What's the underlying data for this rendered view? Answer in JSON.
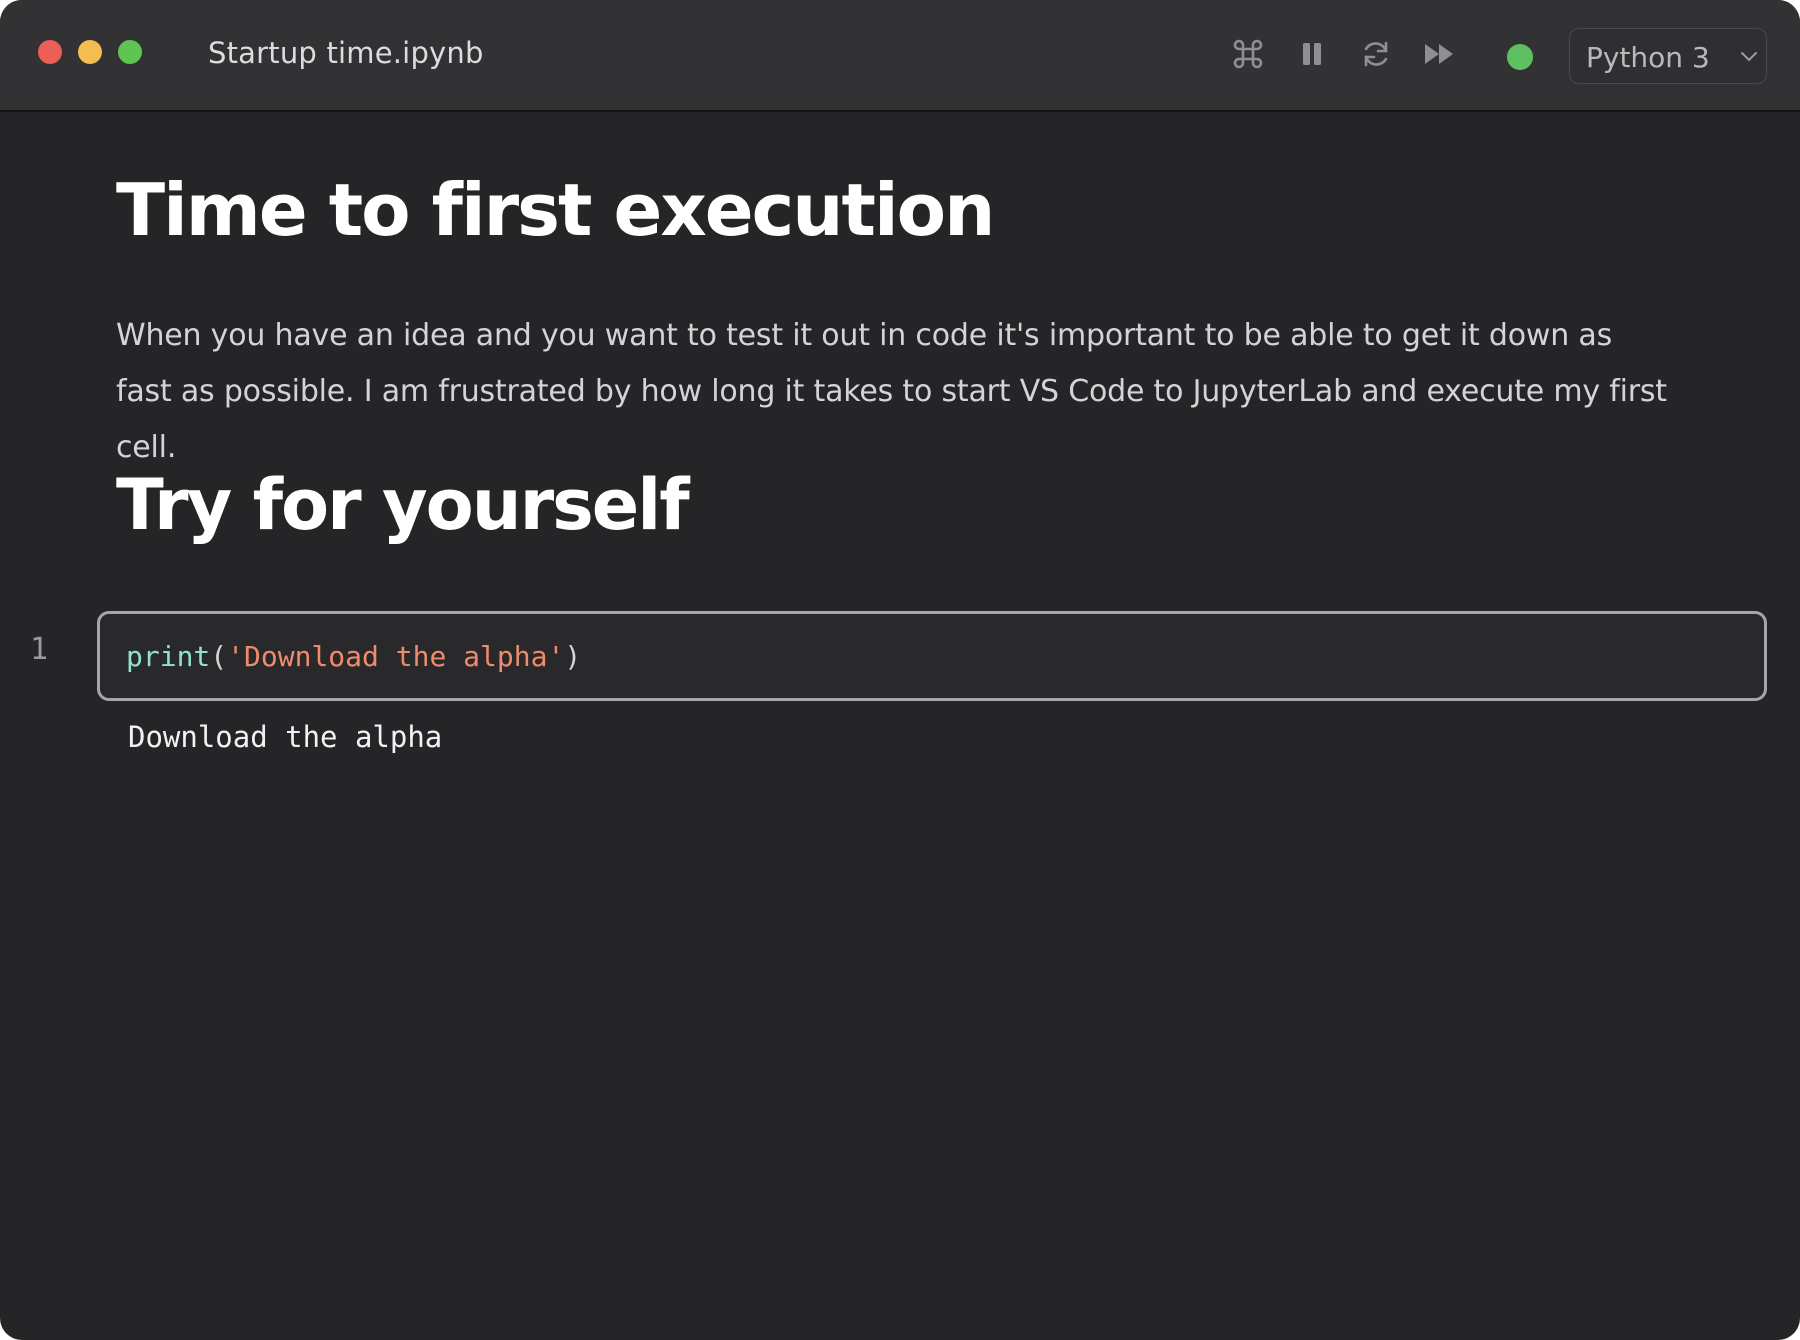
{
  "window": {
    "title": "Startup time.ipynb"
  },
  "toolbar": {
    "icons": [
      "command-icon",
      "pause-icon",
      "restart-icon",
      "run-all-icon"
    ],
    "kernel_status_color": "#5ec15f",
    "kernel": "Python 3"
  },
  "notebook": {
    "heading_1": "Time to first execution",
    "paragraph": "When you have an idea and you want to test it out in code it's important to be able to get it down as fast as possible. I am frustrated by how long it takes to start VS Code to JupyterLab and execute my first cell.",
    "heading_2": "Try for yourself",
    "cell": {
      "execution_count": "1",
      "code_fn": "print",
      "code_open": "(",
      "code_string": "'Download the alpha'",
      "code_close": ")",
      "output": "Download the alpha"
    }
  }
}
